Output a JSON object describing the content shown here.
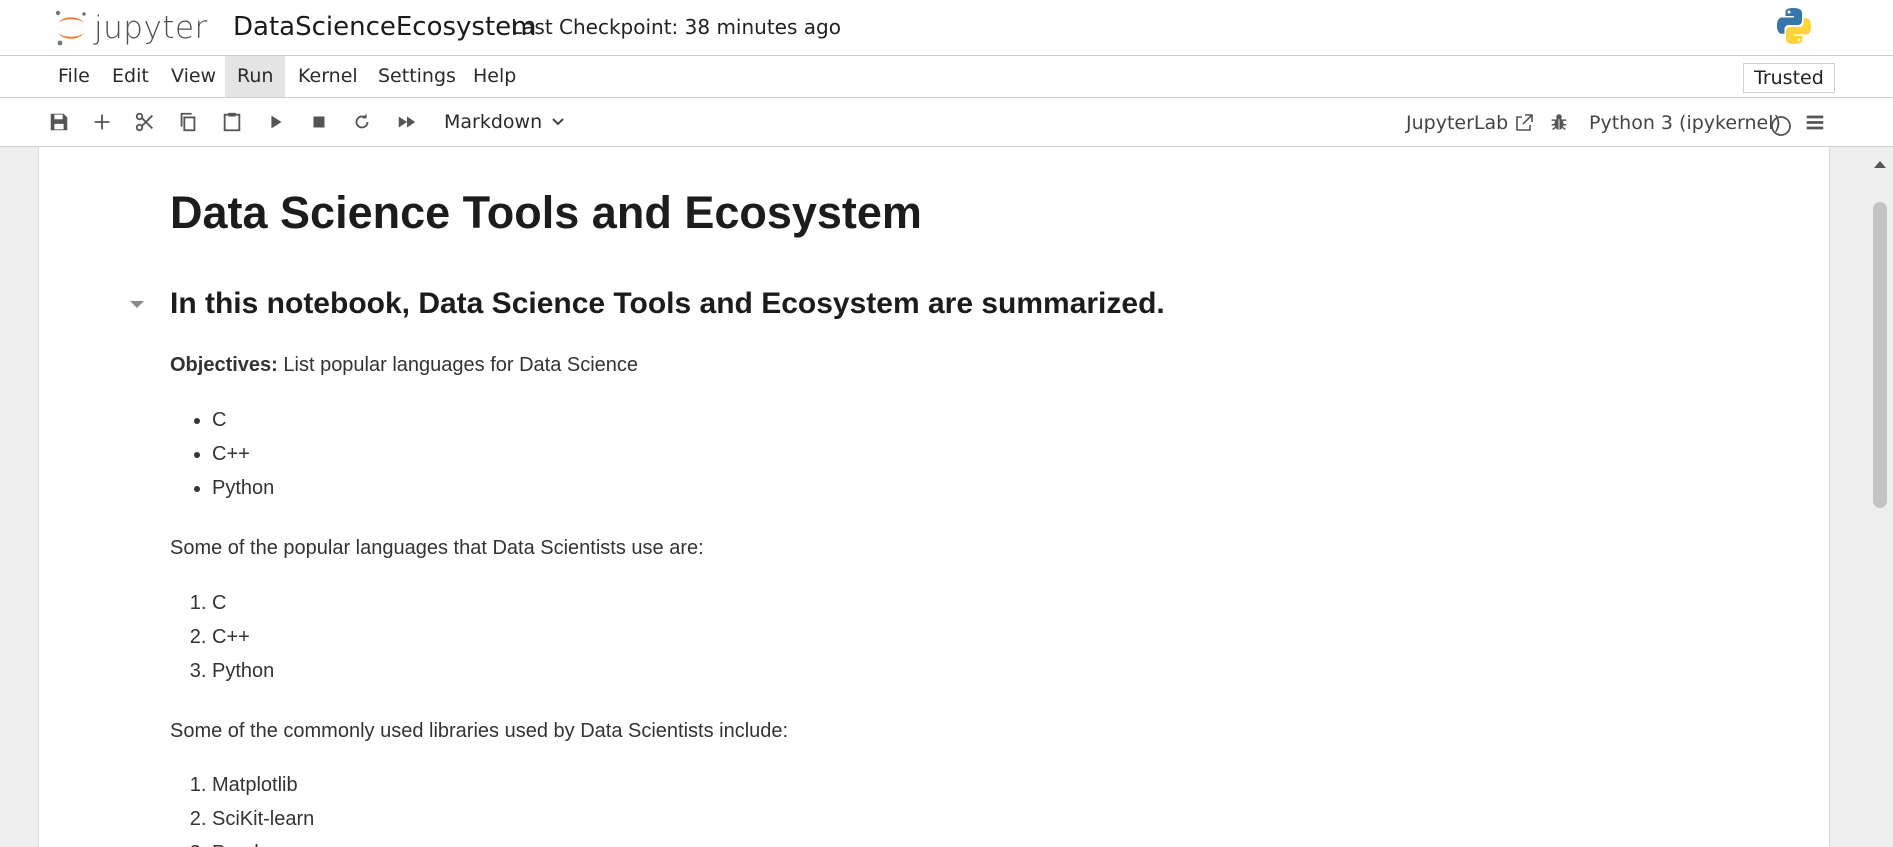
{
  "header": {
    "logo_text": "jupyter",
    "notebook_title": "DataScienceEcosystem",
    "checkpoint": "Last Checkpoint: 38 minutes ago",
    "kernel_logo_icon": "python-logo-icon"
  },
  "menubar": {
    "items": [
      "File",
      "Edit",
      "View",
      "Run",
      "Kernel",
      "Settings",
      "Help"
    ],
    "active_item": "Run",
    "trusted_label": "Trusted"
  },
  "toolbar": {
    "buttons": [
      "save-icon",
      "add-cell-icon",
      "cut-icon",
      "copy-icon",
      "paste-icon",
      "run-icon",
      "stop-icon",
      "restart-icon",
      "fast-forward-icon"
    ],
    "cell_type": "Markdown",
    "jupyterlab_label": "JupyterLab",
    "kernel_name": "Python 3 (ipykernel)",
    "kernel_status": "idle"
  },
  "notebook": {
    "h1": "Data Science Tools and Ecosystem",
    "h2": "In this notebook, Data Science Tools and Ecosystem are summarized.",
    "objectives_label": "Objectives:",
    "objectives_text": " List popular languages for Data Science",
    "objectives_list": [
      "C",
      "C++",
      "Python"
    ],
    "languages_intro": "Some of the popular languages that Data Scientists use are:",
    "languages_list": [
      "C",
      "C++",
      "Python"
    ],
    "libraries_intro": "Some of the commonly used libraries used by Data Scientists include:",
    "libraries_list": [
      "Matplotlib",
      "SciKit-learn",
      "Pandas"
    ]
  },
  "colors": {
    "jupyter_orange": "#F37726",
    "python_blue": "#3776AB",
    "python_yellow": "#FFD43B"
  }
}
